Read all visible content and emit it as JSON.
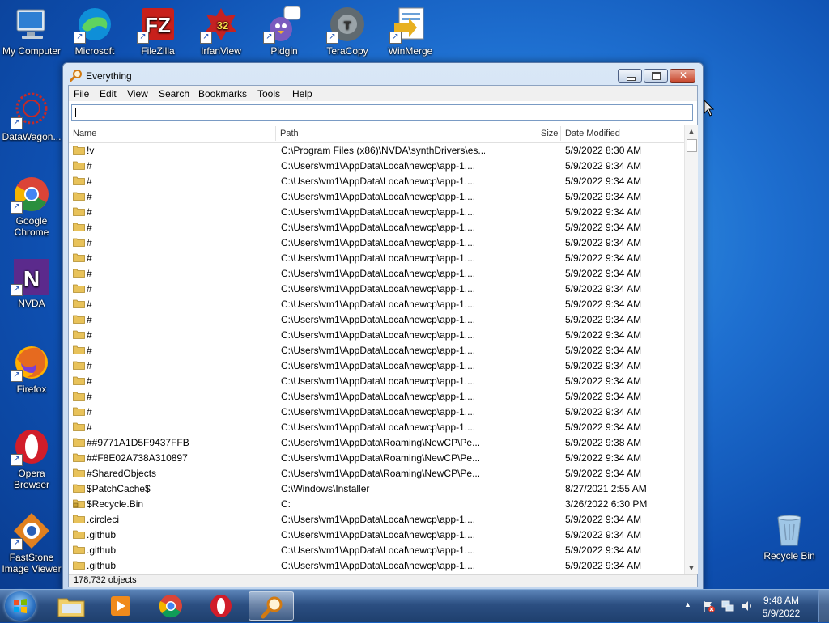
{
  "desktop_icons": [
    {
      "id": "my-computer",
      "label": "My Computer",
      "color": "#2d7fd3"
    },
    {
      "id": "microsoft",
      "label": "Microsoft",
      "color": "#0f8fd8"
    },
    {
      "id": "filezilla",
      "label": "FileZilla",
      "color": "#c8201b"
    },
    {
      "id": "irfanview",
      "label": "IrfanView",
      "color": "#c42222",
      "badge": "32"
    },
    {
      "id": "pidgin",
      "label": "Pidgin",
      "color": "#7a5bbf"
    },
    {
      "id": "teracopy",
      "label": "TeraCopy",
      "color": "#606a70",
      "badge": "T"
    },
    {
      "id": "winmerge",
      "label": "WinMerge",
      "color": "#e8b020"
    },
    {
      "id": "datawagon",
      "label": "DataWagon...",
      "color": "#c22a2a"
    },
    {
      "id": "google-chrome",
      "label": "Google Chrome",
      "color": "#2a8f3e"
    },
    {
      "id": "nvda",
      "label": "NVDA",
      "color": "#5b2a8c"
    },
    {
      "id": "firefox",
      "label": "Firefox",
      "color": "#e66a1f"
    },
    {
      "id": "opera",
      "label": "Opera Browser",
      "color": "#d11d2a"
    },
    {
      "id": "faststone",
      "label": "FastStone Image Viewer",
      "color": "#e0801f"
    },
    {
      "id": "recycle-bin",
      "label": "Recycle Bin",
      "color": "#9fc6e6"
    }
  ],
  "window": {
    "title": "Everything",
    "menu": [
      "File",
      "Edit",
      "View",
      "Search",
      "Bookmarks",
      "Tools",
      "Help"
    ],
    "search_value": "",
    "columns": {
      "name": "Name",
      "path": "Path",
      "size": "Size",
      "date": "Date Modified"
    },
    "rows": [
      {
        "name": "!v",
        "path": "C:\\Program Files (x86)\\NVDA\\synthDrivers\\es...",
        "date": "5/9/2022 8:30 AM",
        "icon": "folder"
      },
      {
        "name": "#",
        "path": "C:\\Users\\vm1\\AppData\\Local\\newcp\\app-1....",
        "date": "5/9/2022 9:34 AM",
        "icon": "folder"
      },
      {
        "name": "#",
        "path": "C:\\Users\\vm1\\AppData\\Local\\newcp\\app-1....",
        "date": "5/9/2022 9:34 AM",
        "icon": "folder"
      },
      {
        "name": "#",
        "path": "C:\\Users\\vm1\\AppData\\Local\\newcp\\app-1....",
        "date": "5/9/2022 9:34 AM",
        "icon": "folder"
      },
      {
        "name": "#",
        "path": "C:\\Users\\vm1\\AppData\\Local\\newcp\\app-1....",
        "date": "5/9/2022 9:34 AM",
        "icon": "folder"
      },
      {
        "name": "#",
        "path": "C:\\Users\\vm1\\AppData\\Local\\newcp\\app-1....",
        "date": "5/9/2022 9:34 AM",
        "icon": "folder"
      },
      {
        "name": "#",
        "path": "C:\\Users\\vm1\\AppData\\Local\\newcp\\app-1....",
        "date": "5/9/2022 9:34 AM",
        "icon": "folder"
      },
      {
        "name": "#",
        "path": "C:\\Users\\vm1\\AppData\\Local\\newcp\\app-1....",
        "date": "5/9/2022 9:34 AM",
        "icon": "folder"
      },
      {
        "name": "#",
        "path": "C:\\Users\\vm1\\AppData\\Local\\newcp\\app-1....",
        "date": "5/9/2022 9:34 AM",
        "icon": "folder"
      },
      {
        "name": "#",
        "path": "C:\\Users\\vm1\\AppData\\Local\\newcp\\app-1....",
        "date": "5/9/2022 9:34 AM",
        "icon": "folder"
      },
      {
        "name": "#",
        "path": "C:\\Users\\vm1\\AppData\\Local\\newcp\\app-1....",
        "date": "5/9/2022 9:34 AM",
        "icon": "folder"
      },
      {
        "name": "#",
        "path": "C:\\Users\\vm1\\AppData\\Local\\newcp\\app-1....",
        "date": "5/9/2022 9:34 AM",
        "icon": "folder"
      },
      {
        "name": "#",
        "path": "C:\\Users\\vm1\\AppData\\Local\\newcp\\app-1....",
        "date": "5/9/2022 9:34 AM",
        "icon": "folder"
      },
      {
        "name": "#",
        "path": "C:\\Users\\vm1\\AppData\\Local\\newcp\\app-1....",
        "date": "5/9/2022 9:34 AM",
        "icon": "folder"
      },
      {
        "name": "#",
        "path": "C:\\Users\\vm1\\AppData\\Local\\newcp\\app-1....",
        "date": "5/9/2022 9:34 AM",
        "icon": "folder"
      },
      {
        "name": "#",
        "path": "C:\\Users\\vm1\\AppData\\Local\\newcp\\app-1....",
        "date": "5/9/2022 9:34 AM",
        "icon": "folder"
      },
      {
        "name": "#",
        "path": "C:\\Users\\vm1\\AppData\\Local\\newcp\\app-1....",
        "date": "5/9/2022 9:34 AM",
        "icon": "folder"
      },
      {
        "name": "#",
        "path": "C:\\Users\\vm1\\AppData\\Local\\newcp\\app-1....",
        "date": "5/9/2022 9:34 AM",
        "icon": "folder"
      },
      {
        "name": "#",
        "path": "C:\\Users\\vm1\\AppData\\Local\\newcp\\app-1....",
        "date": "5/9/2022 9:34 AM",
        "icon": "folder"
      },
      {
        "name": "##9771A1D5F9437FFB",
        "path": "C:\\Users\\vm1\\AppData\\Roaming\\NewCP\\Pe...",
        "date": "5/9/2022 9:38 AM",
        "icon": "folder"
      },
      {
        "name": "##F8E02A738A310897",
        "path": "C:\\Users\\vm1\\AppData\\Roaming\\NewCP\\Pe...",
        "date": "5/9/2022 9:34 AM",
        "icon": "folder"
      },
      {
        "name": "#SharedObjects",
        "path": "C:\\Users\\vm1\\AppData\\Roaming\\NewCP\\Pe...",
        "date": "5/9/2022 9:34 AM",
        "icon": "folder"
      },
      {
        "name": "$PatchCache$",
        "path": "C:\\Windows\\Installer",
        "date": "8/27/2021 2:55 AM",
        "icon": "folder"
      },
      {
        "name": "$Recycle.Bin",
        "path": "C:",
        "date": "3/26/2022 6:30 PM",
        "icon": "folder-locked"
      },
      {
        "name": ".circleci",
        "path": "C:\\Users\\vm1\\AppData\\Local\\newcp\\app-1....",
        "date": "5/9/2022 9:34 AM",
        "icon": "folder"
      },
      {
        "name": ".github",
        "path": "C:\\Users\\vm1\\AppData\\Local\\newcp\\app-1....",
        "date": "5/9/2022 9:34 AM",
        "icon": "folder"
      },
      {
        "name": ".github",
        "path": "C:\\Users\\vm1\\AppData\\Local\\newcp\\app-1....",
        "date": "5/9/2022 9:34 AM",
        "icon": "folder"
      },
      {
        "name": ".github",
        "path": "C:\\Users\\vm1\\AppData\\Local\\newcp\\app-1....",
        "date": "5/9/2022 9:34 AM",
        "icon": "folder"
      }
    ],
    "status": "178,732 objects"
  },
  "taskbar": {
    "items": [
      {
        "id": "file-explorer",
        "icon": "folder-icon"
      },
      {
        "id": "media-player",
        "icon": "media-player-icon"
      },
      {
        "id": "chrome",
        "icon": "chrome-icon"
      },
      {
        "id": "opera",
        "icon": "opera-icon"
      },
      {
        "id": "everything",
        "icon": "magnifier-icon",
        "active": true
      }
    ],
    "clock_time": "9:48 AM",
    "clock_date": "5/9/2022"
  },
  "colors": {
    "folder": "#e8c25a",
    "accent": "#1e6fd0"
  }
}
